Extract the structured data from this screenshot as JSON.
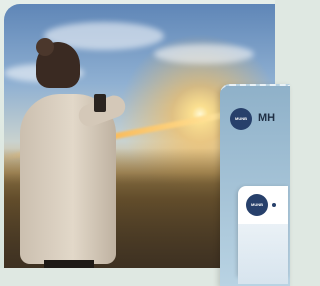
{
  "hero": {
    "alt": ""
  },
  "app_panel": {
    "avatar_text": "MUNB",
    "title": "MH"
  },
  "card": {
    "avatar_text": "MUNB"
  },
  "colors": {
    "brand_navy": "#27406b",
    "panel_blue": "#8fb1c9",
    "sun": "#ffe18c"
  }
}
